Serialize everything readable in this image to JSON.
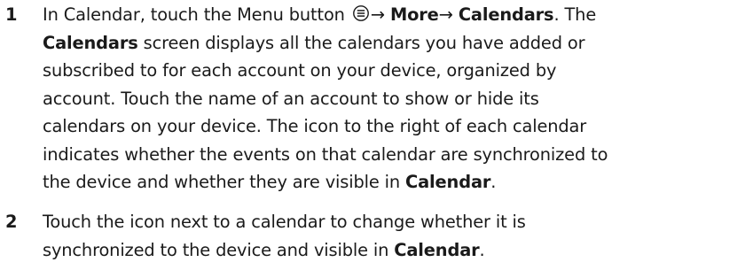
{
  "steps": [
    {
      "number": "1",
      "lines": [
        {
          "t1": "In Calendar, touch the Menu button ",
          "icon": "menu-icon",
          "t2": "→ ",
          "b1": "More",
          "t3": "→ ",
          "b2": "Calendars",
          "t4": ". The"
        },
        {
          "b1": "Calendars",
          "t1": " screen displays all the calendars you have added or"
        },
        {
          "t1": "subscribed to for each account on your device, organized by"
        },
        {
          "t1": "account. Touch the name of an account to show or hide its"
        },
        {
          "t1": "calendars on your device. The icon to the right of each calendar"
        },
        {
          "t1": "indicates whether the events on that calendar are synchronized to"
        },
        {
          "t1": "the device and whether they are visible in ",
          "b1": "Calendar",
          "t2": "."
        }
      ]
    },
    {
      "number": "2",
      "lines": [
        {
          "t1": "Touch the icon next to a calendar to change whether it is"
        },
        {
          "t1": "synchronized to the device and visible in ",
          "b1": "Calendar",
          "t2": "."
        }
      ]
    }
  ]
}
